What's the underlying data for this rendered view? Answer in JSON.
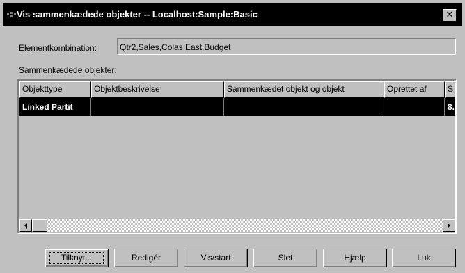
{
  "window": {
    "title": "Vis sammenkædede objekter -- Localhost:Sample:Basic",
    "close_label": "✕"
  },
  "element_combination": {
    "label": "Elementkombination:",
    "value": "Qtr2,Sales,Colas,East,Budget"
  },
  "linked_objects": {
    "label": "Sammenkædede objekter:",
    "columns": [
      "Objekttype",
      "Objektbeskrivelse",
      "Sammenkædet objekt og objekt",
      "Oprettet af",
      "S"
    ],
    "rows": [
      [
        "Linked Partit",
        "",
        "",
        "",
        "8."
      ]
    ]
  },
  "buttons": {
    "attach": "Tilknyt...",
    "edit": "Redigér",
    "view_start": "Vis/start",
    "delete": "Slet",
    "help": "Hjælp",
    "close": "Luk"
  },
  "icons": {
    "app": "app-icon",
    "close": "close-icon",
    "scroll_left": "arrow-left-icon",
    "scroll_right": "arrow-right-icon"
  }
}
